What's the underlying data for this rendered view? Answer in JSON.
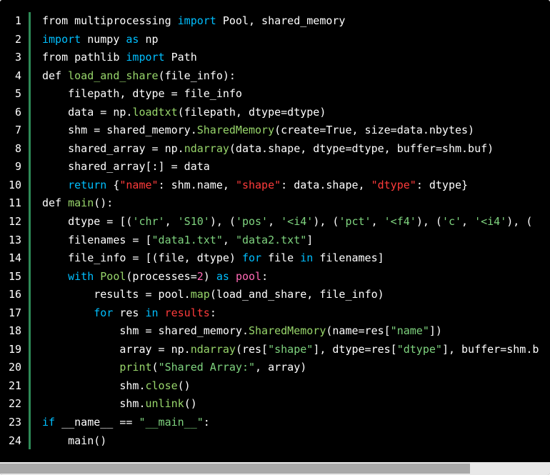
{
  "editor": {
    "line_numbers": [
      "1",
      "2",
      "3",
      "4",
      "5",
      "6",
      "7",
      "8",
      "9",
      "10",
      "11",
      "12",
      "13",
      "14",
      "15",
      "16",
      "17",
      "18",
      "19",
      "20",
      "21",
      "22",
      "23",
      "24"
    ],
    "lines": [
      [
        [
          "from multiprocessing ",
          ""
        ],
        [
          "import",
          "kw"
        ],
        [
          " Pool, shared_memory",
          ""
        ]
      ],
      [
        [
          "import",
          "kw"
        ],
        [
          " numpy ",
          ""
        ],
        [
          "as",
          "kw"
        ],
        [
          " np",
          ""
        ]
      ],
      [
        [
          "from pathlib ",
          ""
        ],
        [
          "import",
          "kw"
        ],
        [
          " Path",
          ""
        ]
      ],
      [
        [
          "def ",
          ""
        ],
        [
          "load_and_share",
          "fn"
        ],
        [
          "(file_info):",
          ""
        ]
      ],
      [
        [
          "    filepath, dtype = file_info",
          ""
        ]
      ],
      [
        [
          "    data = np.",
          ""
        ],
        [
          "loadtxt",
          "fn"
        ],
        [
          "(filepath, dtype=dtype)",
          ""
        ]
      ],
      [
        [
          "    shm = shared_memory.",
          ""
        ],
        [
          "SharedMemory",
          "fn"
        ],
        [
          "(create=True, size=data.nbytes)",
          ""
        ]
      ],
      [
        [
          "    shared_array = np.",
          ""
        ],
        [
          "ndarray",
          "fn"
        ],
        [
          "(data.shape, dtype=dtype, buffer=shm.buf)",
          ""
        ]
      ],
      [
        [
          "    shared_array[:] = data",
          ""
        ]
      ],
      [
        [
          "    ",
          ""
        ],
        [
          "return",
          "kw"
        ],
        [
          " {",
          ""
        ],
        [
          "\"name\"",
          "red"
        ],
        [
          ": shm.name, ",
          ""
        ],
        [
          "\"shape\"",
          "red"
        ],
        [
          ": data.shape, ",
          ""
        ],
        [
          "\"dtype\"",
          "red"
        ],
        [
          ": dtype}",
          ""
        ]
      ],
      [
        [
          "def ",
          ""
        ],
        [
          "main",
          "fn"
        ],
        [
          "():",
          ""
        ]
      ],
      [
        [
          "    dtype = [(",
          ""
        ],
        [
          "'chr'",
          "str"
        ],
        [
          ", ",
          ""
        ],
        [
          "'S10'",
          "str"
        ],
        [
          "), (",
          ""
        ],
        [
          "'pos'",
          "str"
        ],
        [
          ", ",
          ""
        ],
        [
          "'<i4'",
          "str"
        ],
        [
          "), (",
          ""
        ],
        [
          "'pct'",
          "str"
        ],
        [
          ", ",
          ""
        ],
        [
          "'<f4'",
          "str"
        ],
        [
          "), (",
          ""
        ],
        [
          "'c'",
          "str"
        ],
        [
          ", ",
          ""
        ],
        [
          "'<i4'",
          "str"
        ],
        [
          "), (",
          ""
        ]
      ],
      [
        [
          "    filenames = [",
          ""
        ],
        [
          "\"data1.txt\"",
          "str"
        ],
        [
          ", ",
          ""
        ],
        [
          "\"data2.txt\"",
          "str"
        ],
        [
          "]",
          ""
        ]
      ],
      [
        [
          "    file_info = [(file, dtype) ",
          ""
        ],
        [
          "for",
          "kw"
        ],
        [
          " file ",
          ""
        ],
        [
          "in",
          "kw"
        ],
        [
          " filenames]",
          ""
        ]
      ],
      [
        [
          "    ",
          ""
        ],
        [
          "with",
          "kw"
        ],
        [
          " ",
          ""
        ],
        [
          "Pool",
          "fn"
        ],
        [
          "(processes=",
          ""
        ],
        [
          "2",
          "pink"
        ],
        [
          ") ",
          ""
        ],
        [
          "as",
          "kw"
        ],
        [
          " ",
          ""
        ],
        [
          "pool",
          "pink"
        ],
        [
          ":",
          ""
        ]
      ],
      [
        [
          "        results = pool.",
          ""
        ],
        [
          "map",
          "fn"
        ],
        [
          "(load_and_share, file_info)",
          ""
        ]
      ],
      [
        [
          "        ",
          ""
        ],
        [
          "for",
          "kw"
        ],
        [
          " res ",
          ""
        ],
        [
          "in",
          "kw"
        ],
        [
          " ",
          ""
        ],
        [
          "results",
          "red"
        ],
        [
          ":",
          ""
        ]
      ],
      [
        [
          "            shm = shared_memory.",
          ""
        ],
        [
          "SharedMemory",
          "fn"
        ],
        [
          "(name=res[",
          ""
        ],
        [
          "\"name\"",
          "str"
        ],
        [
          "])",
          ""
        ]
      ],
      [
        [
          "            array = np.",
          ""
        ],
        [
          "ndarray",
          "fn"
        ],
        [
          "(res[",
          ""
        ],
        [
          "\"shape\"",
          "str"
        ],
        [
          "], dtype=res[",
          ""
        ],
        [
          "\"dtype\"",
          "str"
        ],
        [
          "], buffer=shm.b",
          ""
        ]
      ],
      [
        [
          "            ",
          ""
        ],
        [
          "print",
          "fn"
        ],
        [
          "(",
          ""
        ],
        [
          "\"Shared Array:\"",
          "str"
        ],
        [
          ", array)",
          ""
        ]
      ],
      [
        [
          "            shm.",
          ""
        ],
        [
          "close",
          "fn"
        ],
        [
          "()",
          ""
        ]
      ],
      [
        [
          "            shm.",
          ""
        ],
        [
          "unlink",
          "fn"
        ],
        [
          "()",
          ""
        ]
      ],
      [
        [
          "if",
          "kw"
        ],
        [
          " __name__ == ",
          ""
        ],
        [
          "\"__main__\"",
          "str"
        ],
        [
          ":",
          ""
        ]
      ],
      [
        [
          "    main()",
          ""
        ]
      ]
    ]
  },
  "scrollbar": {
    "horizontal_position_fraction": 0.0,
    "visible_fraction": 0.855
  }
}
